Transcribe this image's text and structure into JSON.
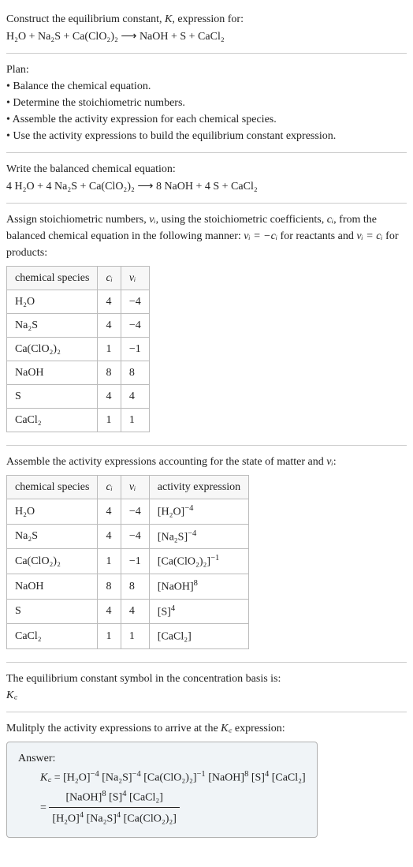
{
  "intro": {
    "line1_a": "Construct the equilibrium constant, ",
    "line1_k": "K",
    "line1_b": ", expression for:",
    "equation_lhs": "H₂O + Na₂S + Ca(ClO₂)₂",
    "arrow": "⟶",
    "equation_rhs": "NaOH + S + CaCl₂"
  },
  "plan": {
    "heading": "Plan:",
    "b1": "• Balance the chemical equation.",
    "b2": "• Determine the stoichiometric numbers.",
    "b3": "• Assemble the activity expression for each chemical species.",
    "b4": "• Use the activity expressions to build the equilibrium constant expression."
  },
  "balanced": {
    "heading": "Write the balanced chemical equation:",
    "lhs": "4 H₂O + 4 Na₂S + Ca(ClO₂)₂",
    "arrow": "⟶",
    "rhs": "8 NaOH + 4 S + CaCl₂"
  },
  "stoich": {
    "text_a": "Assign stoichiometric numbers, ",
    "nu_i": "νᵢ",
    "text_b": ", using the stoichiometric coefficients, ",
    "c_i": "cᵢ",
    "text_c": ", from the balanced chemical equation in the following manner: ",
    "rel1": "νᵢ = −cᵢ",
    "text_d": " for reactants and ",
    "rel2": "νᵢ = cᵢ",
    "text_e": " for products:",
    "th1": "chemical species",
    "th2": "cᵢ",
    "th3": "νᵢ",
    "rows": [
      {
        "sp": "H₂O",
        "c": "4",
        "v": "−4"
      },
      {
        "sp": "Na₂S",
        "c": "4",
        "v": "−4"
      },
      {
        "sp": "Ca(ClO₂)₂",
        "c": "1",
        "v": "−1"
      },
      {
        "sp": "NaOH",
        "c": "8",
        "v": "8"
      },
      {
        "sp": "S",
        "c": "4",
        "v": "4"
      },
      {
        "sp": "CaCl₂",
        "c": "1",
        "v": "1"
      }
    ]
  },
  "activity": {
    "text_a": "Assemble the activity expressions accounting for the state of matter and ",
    "nu_i": "νᵢ",
    "text_b": ":",
    "th1": "chemical species",
    "th2": "cᵢ",
    "th3": "νᵢ",
    "th4": "activity expression",
    "rows": [
      {
        "sp": "H₂O",
        "c": "4",
        "v": "−4",
        "base": "[H₂O]",
        "exp": "−4"
      },
      {
        "sp": "Na₂S",
        "c": "4",
        "v": "−4",
        "base": "[Na₂S]",
        "exp": "−4"
      },
      {
        "sp": "Ca(ClO₂)₂",
        "c": "1",
        "v": "−1",
        "base": "[Ca(ClO₂)₂]",
        "exp": "−1"
      },
      {
        "sp": "NaOH",
        "c": "8",
        "v": "8",
        "base": "[NaOH]",
        "exp": "8"
      },
      {
        "sp": "S",
        "c": "4",
        "v": "4",
        "base": "[S]",
        "exp": "4"
      },
      {
        "sp": "CaCl₂",
        "c": "1",
        "v": "1",
        "base": "[CaCl₂]",
        "exp": ""
      }
    ]
  },
  "symbol": {
    "text": "The equilibrium constant symbol in the concentration basis is:",
    "kc": "K꜀"
  },
  "multiply": {
    "text_a": "Mulitply the activity expressions to arrive at the ",
    "kc": "K꜀",
    "text_b": " expression:"
  },
  "answer": {
    "label": "Answer:",
    "kc": "K꜀",
    "eq": " = ",
    "line1_p1": "[H₂O]",
    "line1_e1": "−4",
    "line1_p2": " [Na₂S]",
    "line1_e2": "−4",
    "line1_p3": " [Ca(ClO₂)₂]",
    "line1_e3": "−1",
    "line1_p4": " [NaOH]",
    "line1_e4": "8",
    "line1_p5": " [S]",
    "line1_e5": "4",
    "line1_p6": " [CaCl₂]",
    "eq2": " = ",
    "num_p1": "[NaOH]",
    "num_e1": "8",
    "num_p2": " [S]",
    "num_e2": "4",
    "num_p3": " [CaCl₂]",
    "den_p1": "[H₂O]",
    "den_e1": "4",
    "den_p2": " [Na₂S]",
    "den_e2": "4",
    "den_p3": " [Ca(ClO₂)₂]"
  }
}
